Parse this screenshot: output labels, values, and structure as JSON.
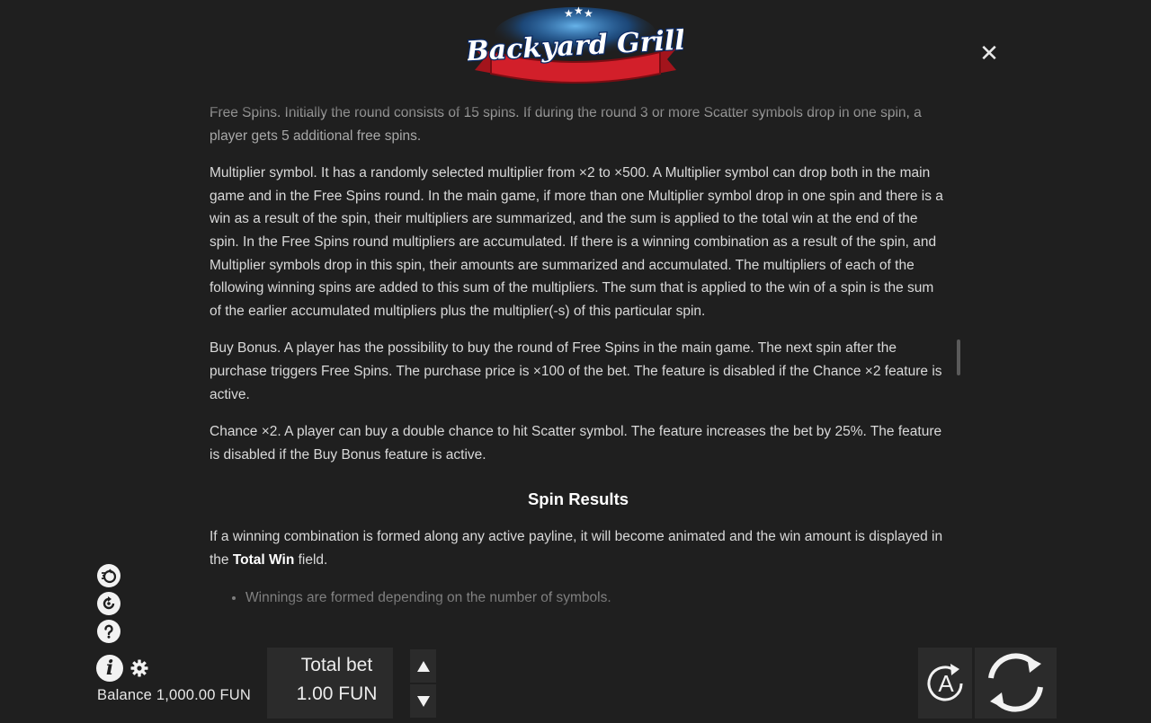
{
  "logo": {
    "text": "Backyard Grill"
  },
  "close": {
    "label": "✕"
  },
  "rules": {
    "p1": "Free Spins. Initially the round consists of 15 spins. If during the round 3 or more Scatter symbols drop in one spin, a player gets 5 additional free spins.",
    "p2": "Multiplier symbol. It has a randomly selected multiplier from ×2 to ×500. A Multiplier symbol can drop both in the main game and in the Free Spins round. In the main game, if more than one Multiplier symbol drop in one spin and there is a win as a result of the spin, their multipliers are summarized, and the sum is applied to the total win at the end of the spin. In the Free Spins round multipliers are accumulated. If there is a winning combination as a result of the spin, and Multiplier symbols drop in this spin, their amounts are summarized and accumulated. The multipliers of each of the following winning spins are added to this sum of the multipliers. The sum that is applied to the win of a spin is the sum of the earlier accumulated multipliers plus the multiplier(-s) of this particular spin.",
    "p3": "Buy Bonus. A player has the possibility to buy the round of Free Spins in the main game. The next spin after the purchase triggers Free Spins. The purchase price is ×100 of the bet. The feature is disabled if the Chance ×2 feature is active.",
    "p4": "Chance ×2. A player can buy a double chance to hit Scatter symbol. The feature increases the bet by 25%. The feature is disabled if the Buy Bonus feature is active.",
    "heading": "Spin Results",
    "p5_a": "If a winning combination is formed along any active payline, it will become animated and the win amount is displayed in the ",
    "p5_b": "Total Win",
    "p5_c": " field.",
    "bullets": [
      "Winnings are formed depending on the number of symbols."
    ]
  },
  "footer": {
    "balance_label": "Balance",
    "balance_value": "1,000.00 FUN",
    "bet_label": "Total bet",
    "bet_value": "1.00 FUN",
    "info_glyph": "i",
    "auto_letter": "A"
  }
}
